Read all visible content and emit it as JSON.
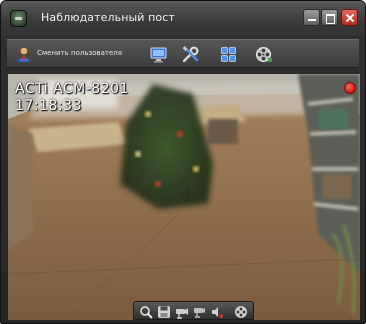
{
  "window": {
    "title": "Наблюдательный пост"
  },
  "toolbar": {
    "switch_user_label": "Сменить пользователя",
    "icons": [
      "user-icon",
      "monitor-icon",
      "tools-icon",
      "grid-layout-icon",
      "film-reel-icon"
    ]
  },
  "video": {
    "camera_name": "ACTi ACM-8201",
    "timestamp": "17:18:33",
    "recording_indicator_color": "#e0281a"
  },
  "controls": {
    "icons": [
      "zoom-icon",
      "save-icon",
      "ptz-camera-icon",
      "ptz-camera-alt-icon",
      "audio-icon",
      "film-reel-icon"
    ]
  },
  "colors": {
    "close_button": "#c8382a",
    "window_frame": "#333333"
  }
}
